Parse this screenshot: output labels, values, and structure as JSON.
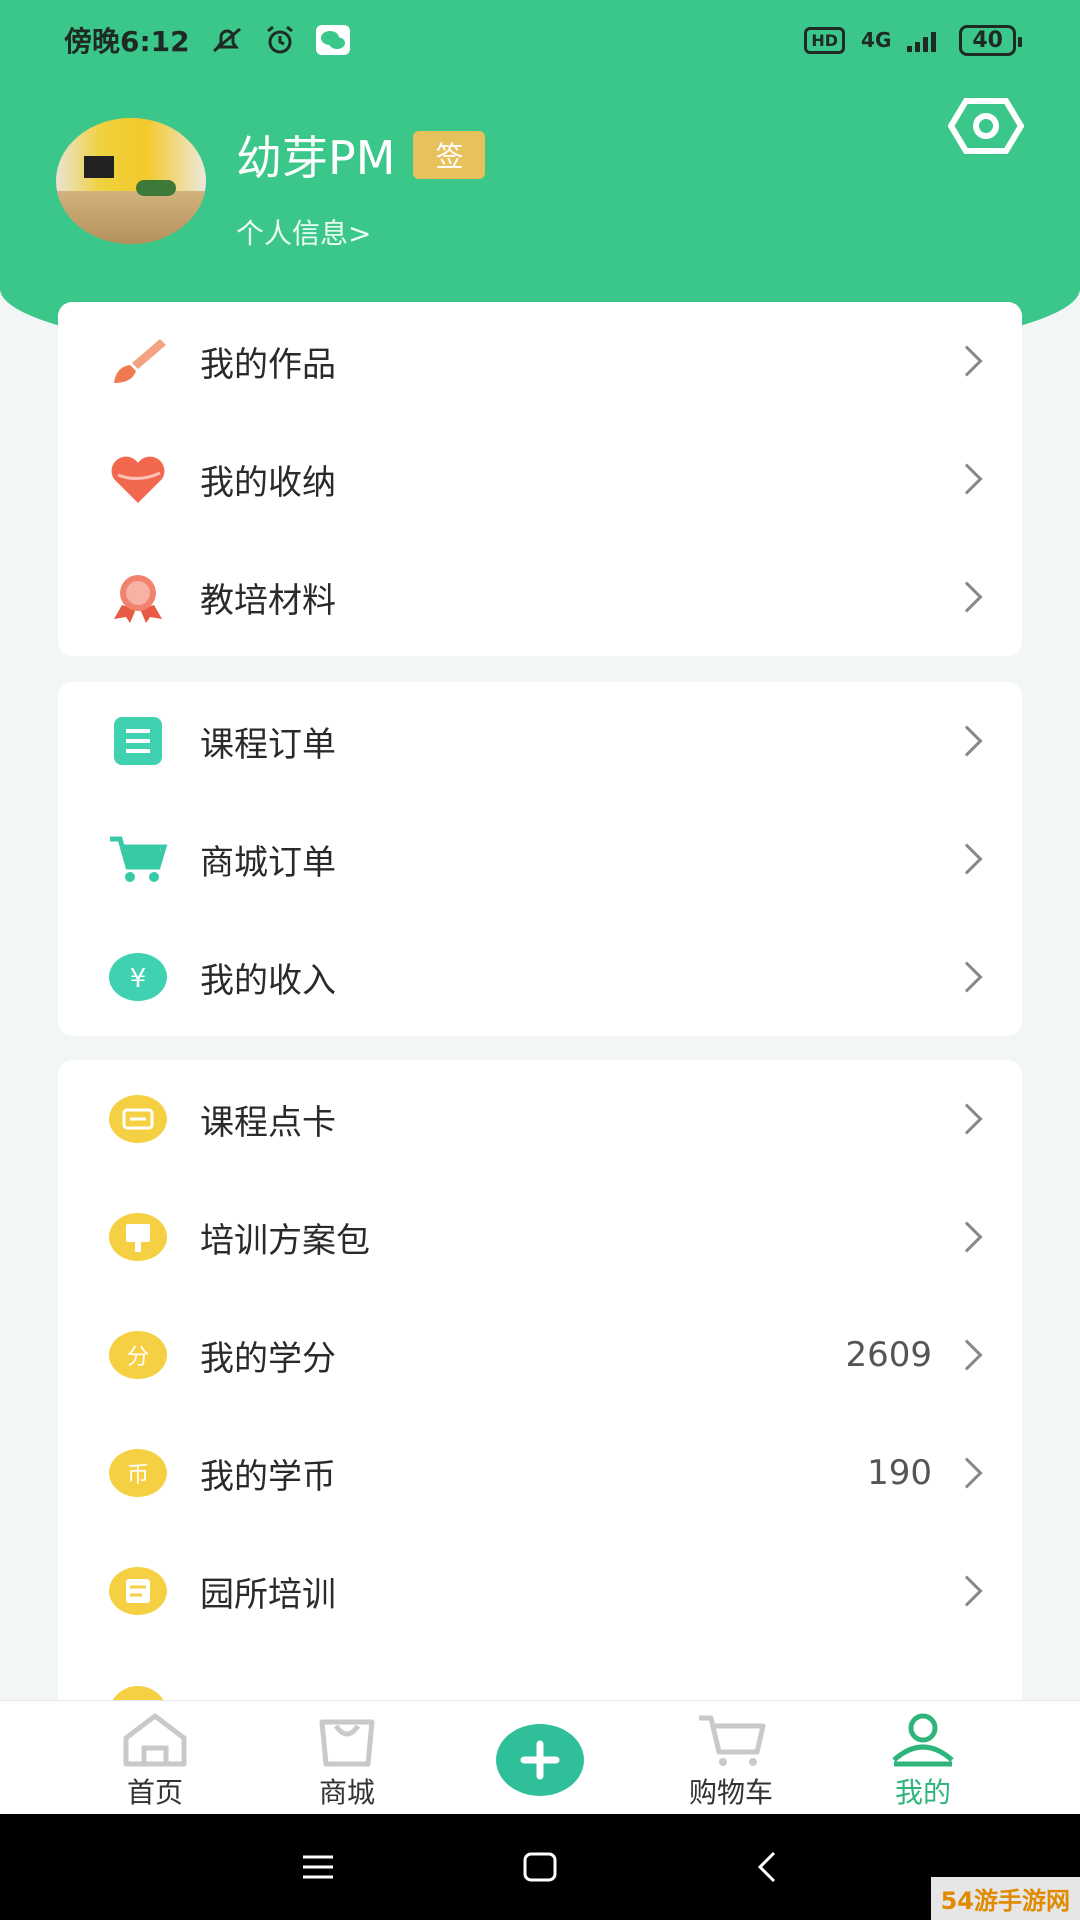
{
  "status_bar": {
    "time": "傍晚6:12",
    "hd": "HD",
    "network": "4G",
    "battery": "40"
  },
  "profile": {
    "name": "幼芽PM",
    "sign_badge": "签",
    "info_link": "个人信息>"
  },
  "menu_groups": [
    {
      "items": [
        {
          "label": "我的作品",
          "icon": "paintbrush-icon"
        },
        {
          "label": "我的收纳",
          "icon": "heart-icon"
        },
        {
          "label": "教培材料",
          "icon": "award-icon"
        }
      ]
    },
    {
      "items": [
        {
          "label": "课程订单",
          "icon": "list-icon"
        },
        {
          "label": "商城订单",
          "icon": "cart-icon"
        },
        {
          "label": "我的收入",
          "icon": "yen-icon"
        }
      ]
    },
    {
      "items": [
        {
          "label": "课程点卡",
          "icon": "ticket-icon",
          "value": ""
        },
        {
          "label": "培训方案包",
          "icon": "package-icon",
          "value": ""
        },
        {
          "label": "我的学分",
          "icon": "credit-icon",
          "value": "2609"
        },
        {
          "label": "我的学币",
          "icon": "coin-icon",
          "value": "190"
        },
        {
          "label": "园所培训",
          "icon": "training-icon",
          "value": ""
        }
      ]
    }
  ],
  "tabbar": {
    "home": "首页",
    "mall": "商城",
    "cart": "购物车",
    "mine": "我的"
  },
  "colors": {
    "primary": "#3cc78a",
    "accent_teal": "#2fbf9b",
    "badge_gold": "#e7c15b"
  },
  "watermark": "54游手游网"
}
